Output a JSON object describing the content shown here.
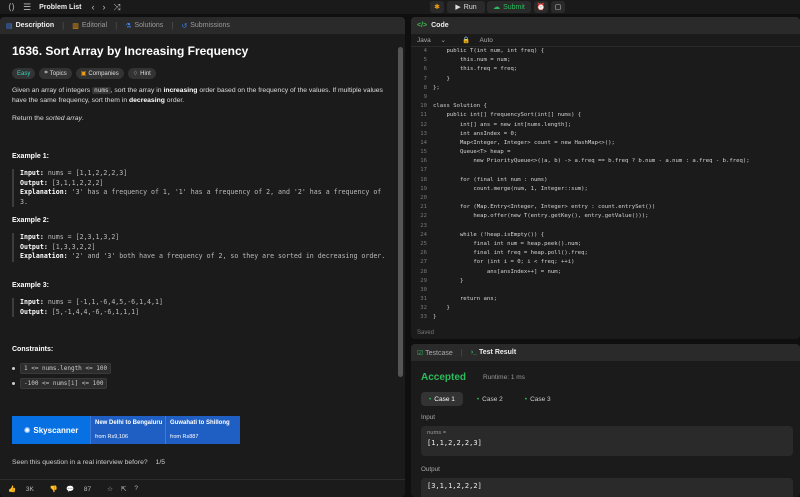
{
  "topbar": {
    "problem_list": "Problem List",
    "run": "Run",
    "submit": "Submit"
  },
  "left_tabs": [
    {
      "label": "Description",
      "icon": "document-icon"
    },
    {
      "label": "Editorial",
      "icon": "book-icon"
    },
    {
      "label": "Solutions",
      "icon": "flask-icon"
    },
    {
      "label": "Submissions",
      "icon": "history-icon"
    }
  ],
  "problem": {
    "title": "1636. Sort Array by Increasing Frequency",
    "chips": [
      "Easy",
      "Topics",
      "Companies",
      "Hint"
    ],
    "desc1a": "Given an array of integers ",
    "desc1code": "nums",
    "desc1b": ", sort the array in ",
    "desc1c": "increasing",
    "desc1d": " order based on the frequency of the values. If multiple values have the same frequency, sort them in ",
    "desc1e": "decreasing",
    "desc1f": " order.",
    "desc2a": "Return the ",
    "desc2b": "sorted array",
    "desc2c": "."
  },
  "examples": [
    {
      "title": "Example 1:",
      "input": "nums = [1,1,2,2,2,3]",
      "output": "[3,1,1,2,2,2]",
      "explanation": "'3' has a frequency of 1, '1' has a frequency of 2, and '2' has a frequency of 3."
    },
    {
      "title": "Example 2:",
      "input": "nums = [2,3,1,3,2]",
      "output": "[1,3,3,2,2]",
      "explanation": "'2' and '3' both have a frequency of 2, so they are sorted in decreasing order."
    },
    {
      "title": "Example 3:",
      "input": "nums = [-1,1,-6,4,5,-6,1,4,1]",
      "output": "[5,-1,4,4,-6,-6,1,1,1]",
      "explanation": ""
    }
  ],
  "labels": {
    "input": "Input:",
    "output": "Output:",
    "explanation": "Explanation:"
  },
  "constraints": {
    "title": "Constraints:",
    "items": [
      "1 <= nums.length <= 100",
      "-100 <= nums[i] <= 100"
    ]
  },
  "ad": {
    "brand": "Skyscanner",
    "route1": "New Delhi to Bengaluru",
    "price1": "from Rs9,106",
    "route2": "Guwahati to Shillong",
    "price2": "from Rs887"
  },
  "seen": {
    "question": "Seen this question in a real interview before?",
    "count": "1/5"
  },
  "footer": {
    "likes": "3K",
    "comments": "87"
  },
  "code": {
    "title": "Code",
    "language": "Java",
    "mode": "Auto",
    "saved": "Saved",
    "lines": [
      {
        "n": "4",
        "t": "    public T(int num, int freq) {"
      },
      {
        "n": "5",
        "t": "        this.num = num;"
      },
      {
        "n": "6",
        "t": "        this.freq = freq;"
      },
      {
        "n": "7",
        "t": "    }"
      },
      {
        "n": "8",
        "t": "};"
      },
      {
        "n": "9",
        "t": ""
      },
      {
        "n": "10",
        "t": "class Solution {"
      },
      {
        "n": "11",
        "t": "    public int[] frequencySort(int[] nums) {"
      },
      {
        "n": "12",
        "t": "        int[] ans = new int[nums.length];"
      },
      {
        "n": "13",
        "t": "        int ansIndex = 0;"
      },
      {
        "n": "14",
        "t": "        Map<Integer, Integer> count = new HashMap<>();"
      },
      {
        "n": "15",
        "t": "        Queue<T> heap ="
      },
      {
        "n": "16",
        "t": "            new PriorityQueue<>((a, b) -> a.freq == b.freq ? b.num - a.num : a.freq - b.freq);"
      },
      {
        "n": "17",
        "t": ""
      },
      {
        "n": "18",
        "t": "        for (final int num : nums)"
      },
      {
        "n": "19",
        "t": "            count.merge(num, 1, Integer::sum);"
      },
      {
        "n": "20",
        "t": ""
      },
      {
        "n": "21",
        "t": "        for (Map.Entry<Integer, Integer> entry : count.entrySet())"
      },
      {
        "n": "22",
        "t": "            heap.offer(new T(entry.getKey(), entry.getValue()));"
      },
      {
        "n": "23",
        "t": ""
      },
      {
        "n": "24",
        "t": "        while (!heap.isEmpty()) {"
      },
      {
        "n": "25",
        "t": "            final int num = heap.peek().num;"
      },
      {
        "n": "26",
        "t": "            final int freq = heap.poll().freq;"
      },
      {
        "n": "27",
        "t": "            for (int i = 0; i < freq; ++i)"
      },
      {
        "n": "28",
        "t": "                ans[ansIndex++] = num;"
      },
      {
        "n": "29",
        "t": "        }"
      },
      {
        "n": "30",
        "t": ""
      },
      {
        "n": "31",
        "t": "        return ans;"
      },
      {
        "n": "32",
        "t": "    }"
      },
      {
        "n": "33",
        "t": "}"
      }
    ]
  },
  "result": {
    "tab_testcase": "Testcase",
    "tab_result": "Test Result",
    "status": "Accepted",
    "runtime": "Runtime: 1 ms",
    "cases": [
      "Case 1",
      "Case 2",
      "Case 3"
    ],
    "input_label": "Input",
    "var_name": "nums =",
    "var_value": "[1,1,2,2,2,3]",
    "output_label": "Output",
    "output_value": "[3,1,1,2,2,2]"
  },
  "colors": {
    "accepted": "#2cbb5d",
    "easy": "#2dd4bf",
    "submit": "#2cbb5d"
  }
}
